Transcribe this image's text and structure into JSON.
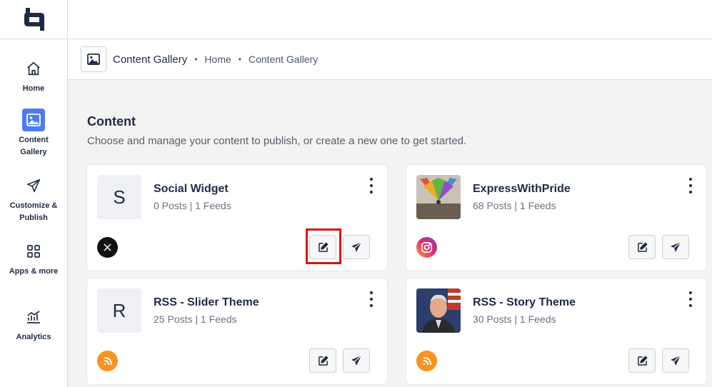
{
  "sidebar": {
    "items": [
      {
        "label": "Home",
        "icon": "home-icon"
      },
      {
        "label": "Content Gallery",
        "icon": "image-icon",
        "active": true
      },
      {
        "label": "Customize & Publish",
        "icon": "send-icon"
      },
      {
        "label": "Apps & more",
        "icon": "grid-icon"
      },
      {
        "label": "Analytics",
        "icon": "analytics-icon"
      }
    ]
  },
  "breadcrumb": {
    "title": "Content Gallery",
    "home": "Home",
    "current": "Content Gallery"
  },
  "content": {
    "title": "Content",
    "subtitle": "Choose and manage your content to publish, or create a new one to get started."
  },
  "cards": [
    {
      "title": "Social Widget",
      "meta": "0 Posts | 1 Feeds",
      "initial": "S",
      "platform": "x-icon"
    },
    {
      "title": "ExpressWithPride",
      "meta": "68 Posts | 1 Feeds",
      "initial": "",
      "platform": "instagram-icon"
    },
    {
      "title": "RSS - Slider Theme",
      "meta": "25 Posts | 1 Feeds",
      "initial": "R",
      "platform": "rss-icon"
    },
    {
      "title": "RSS - Story Theme",
      "meta": "30 Posts | 1 Feeds",
      "initial": "",
      "platform": "rss-icon"
    }
  ],
  "colors": {
    "accent": "#4c7cf3",
    "rss": "#f7931e",
    "highlight": "#e01010",
    "text": "#1f2a44"
  }
}
